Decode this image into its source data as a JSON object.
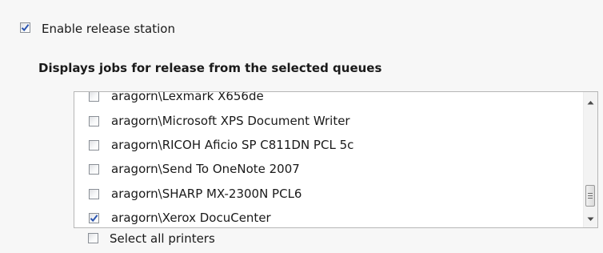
{
  "enable_release_station": {
    "label": "Enable release station",
    "checked": true
  },
  "queues_section": {
    "heading": "Displays jobs for release from the selected queues",
    "queues": [
      {
        "label": "aragorn\\Lexmark X656de",
        "checked": false
      },
      {
        "label": "aragorn\\Microsoft XPS Document Writer",
        "checked": false
      },
      {
        "label": "aragorn\\RICOH Aficio SP C811DN PCL 5c",
        "checked": false
      },
      {
        "label": "aragorn\\Send To OneNote 2007",
        "checked": false
      },
      {
        "label": "aragorn\\SHARP MX-2300N PCL6",
        "checked": false
      },
      {
        "label": "aragorn\\Xerox DocuCenter",
        "checked": true
      }
    ]
  },
  "select_all_printers": {
    "label": "Select all printers",
    "checked": false
  },
  "colors": {
    "background": "#f7f7f7",
    "check_mark": "#2b55b0",
    "list_border": "#b6b6b6"
  }
}
